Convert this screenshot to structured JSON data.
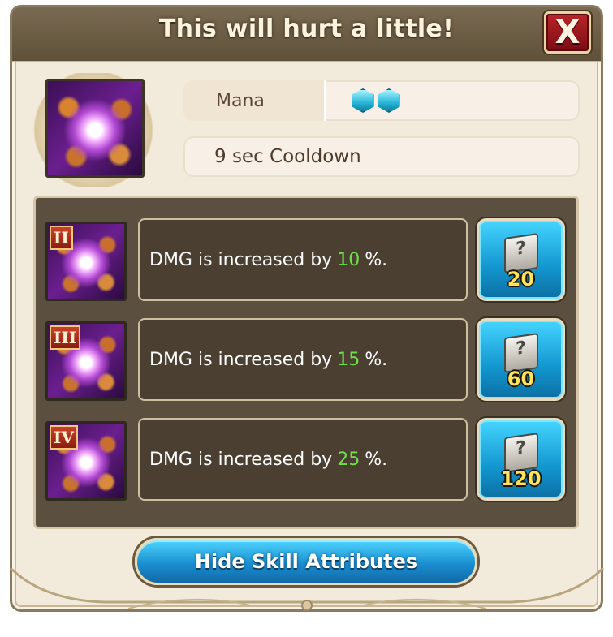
{
  "dialog": {
    "title": "This will hurt a little!",
    "close_label": "X"
  },
  "skill": {
    "icon": "spiral-burst-skill-icon",
    "mana_label": "Mana",
    "mana_cost": 2,
    "cooldown_text": "9 sec Cooldown"
  },
  "levels": [
    {
      "roman": "II",
      "prefix": "DMG is increased by",
      "percent": "10",
      "suffix": "%.",
      "cost": "20",
      "cost_icon": "skill-book-icon"
    },
    {
      "roman": "III",
      "prefix": "DMG is increased by",
      "percent": "15",
      "suffix": "%.",
      "cost": "60",
      "cost_icon": "skill-book-icon"
    },
    {
      "roman": "IV",
      "prefix": "DMG is increased by",
      "percent": "25",
      "suffix": "%.",
      "cost": "120",
      "cost_icon": "skill-book-icon"
    }
  ],
  "hide_button_label": "Hide Skill Attributes",
  "colors": {
    "header": "#6b5b44",
    "panel": "#f2eadb",
    "attr_panel": "#5b4f3f",
    "percent_highlight": "#6fe04a",
    "cost_button": "#1aa7e0",
    "close_button": "#a01c22"
  }
}
